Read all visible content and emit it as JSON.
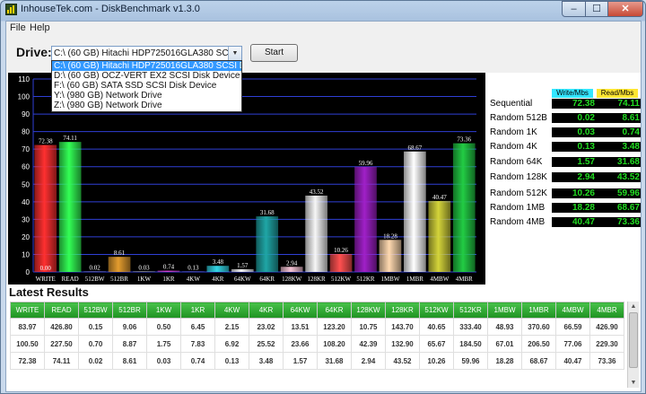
{
  "window": {
    "title": "InhouseTek.com - DiskBenchmark v1.3.0",
    "min_glyph": "–",
    "max_glyph": "☐",
    "close_glyph": "✕"
  },
  "menu": {
    "file": "File",
    "help": "Help"
  },
  "toolbar": {
    "drive_label": "Drive:",
    "selected_drive": "C:\\ (60 GB) Hitachi HDP725016GLA380 SCSI Disk Device",
    "dropdown_arrow": "▼",
    "start_label": "Start"
  },
  "drive_options": [
    "C:\\ (60 GB) Hitachi HDP725016GLA380 SCSI Disk Device",
    "D:\\ (60 GB) OCZ-VERT EX2 SCSI Disk Device",
    "F:\\ (60 GB) SATA SSD SCSI Disk Device",
    "Y:\\ (980 GB) Network Drive",
    "Z:\\ (980 GB) Network Drive"
  ],
  "chart_data": {
    "type": "bar",
    "ylim": [
      0,
      110
    ],
    "yticks": [
      0,
      10,
      20,
      30,
      40,
      50,
      60,
      70,
      80,
      90,
      100,
      110
    ],
    "grid": true,
    "categories": [
      "WRITE",
      "READ",
      "512BW",
      "512BR",
      "1KW",
      "1KR",
      "4KW",
      "4KR",
      "64KW",
      "64KR",
      "128KW",
      "128KR",
      "512KW",
      "512KR",
      "1MBW",
      "1MBR",
      "4MBW",
      "4MBR"
    ],
    "values": [
      72.38,
      74.11,
      0.02,
      8.61,
      0.03,
      0.74,
      0.13,
      3.48,
      1.57,
      31.68,
      2.94,
      43.52,
      10.26,
      59.96,
      18.28,
      68.67,
      40.47,
      73.36
    ],
    "value_labels": [
      "72.38",
      "74.11",
      "0.02",
      "8.61",
      "0.03",
      "0.74",
      "0.13",
      "3.48",
      "1.57",
      "31.68",
      "2.94",
      "43.52",
      "10.26",
      "59.96",
      "18.28",
      "68.67",
      "40.47",
      "73.36"
    ],
    "baseline_labels": [
      "0.00",
      "",
      "",
      "",
      "",
      "",
      "",
      "",
      "",
      "",
      "",
      "",
      "",
      "",
      "",
      "",
      "",
      ""
    ],
    "colors": [
      "#ff3030",
      "#33ff55",
      "#8a8aff",
      "#e39c2e",
      "#c9c9c9",
      "#d040d0",
      "#6a6aff",
      "#33d6e6",
      "#f0f0f0",
      "#1fa6a6",
      "#f4c2d4",
      "#f6f6f6",
      "#ff5050",
      "#a020c8",
      "#ffd9b0",
      "#ffffff",
      "#d4d43a",
      "#22cc44"
    ]
  },
  "summary": {
    "write_header": "Write/Mbs",
    "read_header": "Read/Mbs",
    "write_header_color": "#33e6ff",
    "read_header_color": "#ffe633",
    "rows": [
      {
        "label": "Sequential",
        "write": "72.38",
        "read": "74.11"
      },
      {
        "label": "Random 512B",
        "write": "0.02",
        "read": "8.61"
      },
      {
        "label": "Random 1K",
        "write": "0.03",
        "read": "0.74"
      },
      {
        "label": "Random 4K",
        "write": "0.13",
        "read": "3.48"
      },
      {
        "label": "Random 64K",
        "write": "1.57",
        "read": "31.68"
      },
      {
        "label": "Random 128K",
        "write": "2.94",
        "read": "43.52"
      },
      {
        "label": "Random 512K",
        "write": "10.26",
        "read": "59.96"
      },
      {
        "label": "Random 1MB",
        "write": "18.28",
        "read": "68.67"
      },
      {
        "label": "Random 4MB",
        "write": "40.47",
        "read": "73.36"
      }
    ]
  },
  "results": {
    "title": "Latest Results",
    "columns": [
      "WRITE",
      "READ",
      "512BW",
      "512BR",
      "1KW",
      "1KR",
      "4KW",
      "4KR",
      "64KW",
      "64KR",
      "128KW",
      "128KR",
      "512KW",
      "512KR",
      "1MBW",
      "1MBR",
      "4MBW",
      "4MBR"
    ],
    "rows": [
      [
        "83.97",
        "426.80",
        "0.15",
        "9.06",
        "0.50",
        "6.45",
        "2.15",
        "23.02",
        "13.51",
        "123.20",
        "10.75",
        "143.70",
        "40.65",
        "333.40",
        "48.93",
        "370.60",
        "66.59",
        "426.90"
      ],
      [
        "100.50",
        "227.50",
        "0.70",
        "8.87",
        "1.75",
        "7.83",
        "6.92",
        "25.52",
        "23.66",
        "108.20",
        "42.39",
        "132.90",
        "65.67",
        "184.50",
        "67.01",
        "206.50",
        "77.06",
        "229.30"
      ],
      [
        "72.38",
        "74.11",
        "0.02",
        "8.61",
        "0.03",
        "0.74",
        "0.13",
        "3.48",
        "1.57",
        "31.68",
        "2.94",
        "43.52",
        "10.26",
        "59.96",
        "18.28",
        "68.67",
        "40.47",
        "73.36"
      ]
    ],
    "scroll_up_glyph": "▲",
    "scroll_down_glyph": "▼"
  }
}
